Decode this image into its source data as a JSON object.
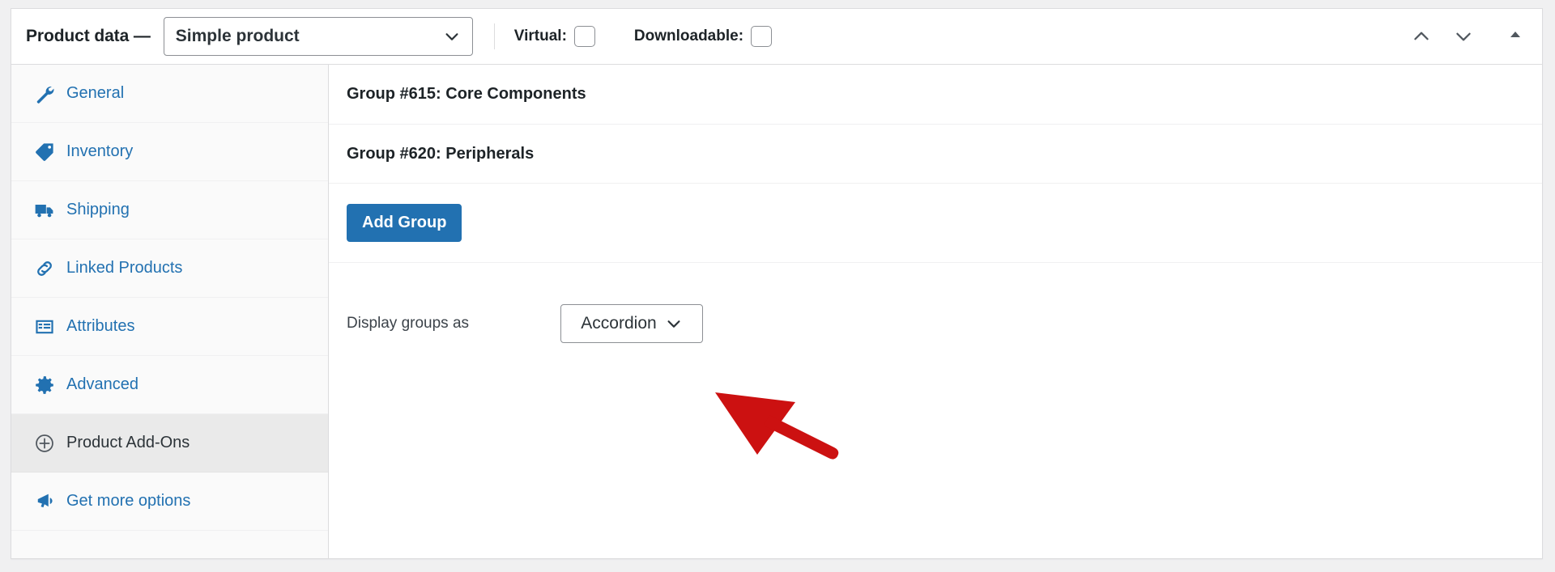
{
  "panel": {
    "title": "Product data —",
    "product_type": {
      "selected": "Simple product",
      "icon": "chevron-down-icon"
    },
    "checkboxes": [
      {
        "label": "Virtual:",
        "checked": false,
        "name": "virtual"
      },
      {
        "label": "Downloadable:",
        "checked": false,
        "name": "downloadable"
      }
    ],
    "actions": [
      {
        "name": "move-up-button",
        "icon": "chevron-up-icon"
      },
      {
        "name": "move-down-button",
        "icon": "chevron-down-icon"
      },
      {
        "name": "toggle-panel-button",
        "icon": "triangle-up-icon"
      }
    ]
  },
  "sidebar": {
    "items": [
      {
        "label": "General",
        "icon": "wrench-icon",
        "active": false
      },
      {
        "label": "Inventory",
        "icon": "tag-icon",
        "active": false
      },
      {
        "label": "Shipping",
        "icon": "truck-icon",
        "active": false
      },
      {
        "label": "Linked Products",
        "icon": "link-icon",
        "active": false
      },
      {
        "label": "Attributes",
        "icon": "list-view-icon",
        "active": false
      },
      {
        "label": "Advanced",
        "icon": "gear-icon",
        "active": false
      },
      {
        "label": "Product Add-Ons",
        "icon": "plus-circle-icon",
        "active": true
      },
      {
        "label": "Get more options",
        "icon": "megaphone-icon",
        "active": false
      }
    ]
  },
  "content": {
    "groups": [
      {
        "heading": "Group #615: Core Components"
      },
      {
        "heading": "Group #620: Peripherals"
      }
    ],
    "add_group_button": "Add Group",
    "display_groups": {
      "label": "Display groups as",
      "selected": "Accordion",
      "icon": "chevron-down-icon"
    }
  },
  "annotation": {
    "type": "arrow",
    "color": "#cc1111",
    "points_to": "display-groups-select"
  },
  "colors": {
    "accent_blue": "#2271b1",
    "panel_border": "#dcdcde",
    "active_tab_bg": "#eaeaea",
    "arrow_red": "#cc1111"
  }
}
